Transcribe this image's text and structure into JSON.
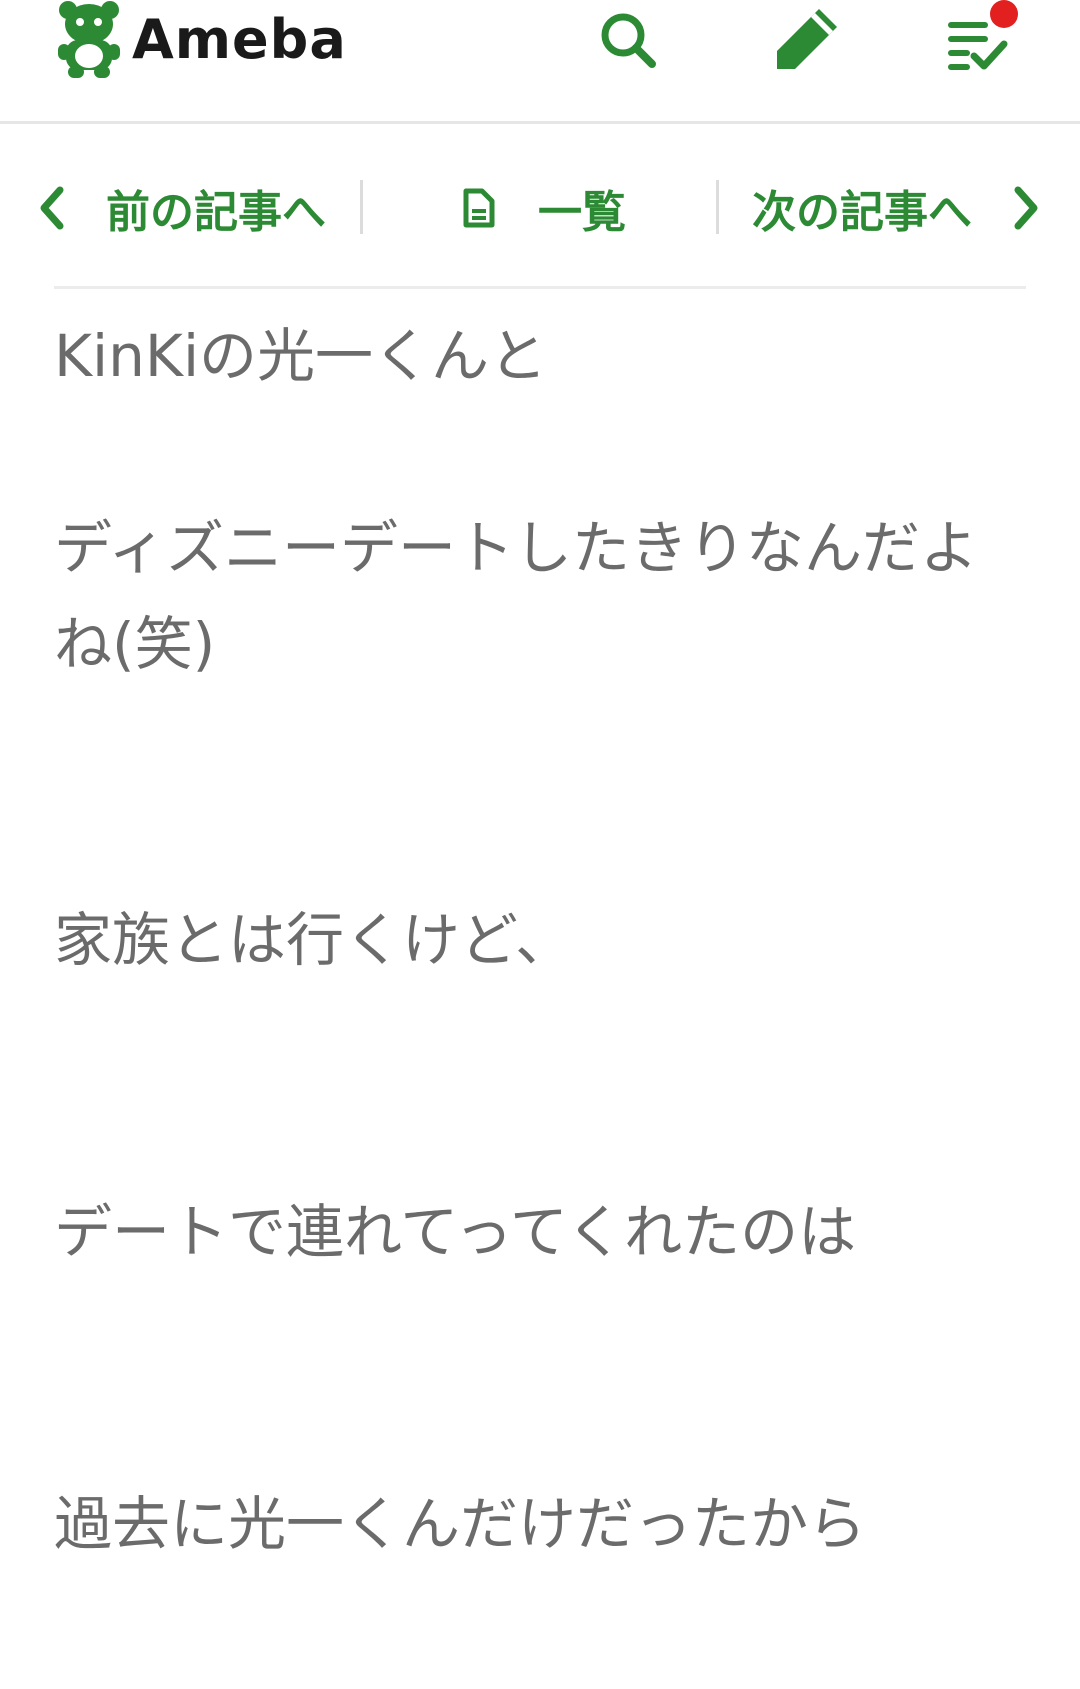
{
  "header": {
    "logo_text": "Ameba",
    "icons": [
      "search-icon",
      "pencil-icon",
      "feed-icon"
    ],
    "notification_dot_color": "#e32020",
    "accent_color": "#2d8a34"
  },
  "article_nav": {
    "prev_label": "前の記事へ",
    "list_label": "一覧",
    "next_label": "次の記事へ"
  },
  "body": {
    "paragraphs": [
      "KinKiの光一くんと",
      "ディズニーデートしたきりなんだよね(笑)",
      "家族とは行くけど、",
      "デートで連れてってくれたのは",
      "過去に光一くんだけだったから"
    ]
  }
}
